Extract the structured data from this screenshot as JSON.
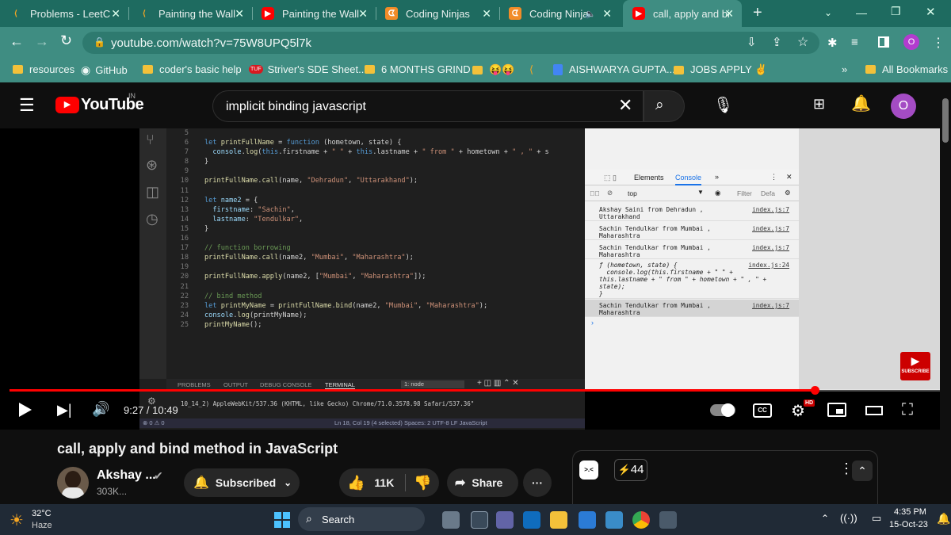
{
  "browser": {
    "tabs": [
      {
        "title": "Problems - LeetC",
        "icon": "leetcode-icon"
      },
      {
        "title": "Painting the Wall",
        "icon": "leetcode-icon"
      },
      {
        "title": "Painting the Wall",
        "icon": "youtube-icon"
      },
      {
        "title": "Coding Ninjas",
        "icon": "codingninjas-icon"
      },
      {
        "title": "Coding Ninja",
        "icon": "codingninjas-icon"
      },
      {
        "title": "call, apply and bi",
        "icon": "youtube-icon",
        "active": true
      }
    ],
    "new_tab": "+",
    "url": "youtube.com/watch?v=75W8UPQ5l7k",
    "profile_initial": "O",
    "bookmarks": [
      {
        "label": "resources",
        "icon": "folder-icon"
      },
      {
        "label": "GitHub",
        "icon": "github-icon"
      },
      {
        "label": "coder's basic help",
        "icon": "folder-icon"
      },
      {
        "label": "Striver's SDE Sheet...",
        "icon": "tuf-icon"
      },
      {
        "label": "6 MONTHS GRIND",
        "icon": "folder-icon"
      },
      {
        "label": "😝😝",
        "icon": "folder-icon"
      },
      {
        "label": "AISHWARYA GUPTA...",
        "icon": "docs-icon"
      },
      {
        "label": "JOBS APPLY ✌",
        "icon": "folder-icon"
      }
    ],
    "bookmarks_overflow": "»",
    "all_bookmarks": "All Bookmarks"
  },
  "youtube": {
    "logo_text": "YouTube",
    "region": "IN",
    "search_query": "implicit binding javascript",
    "avatar_initial": "O"
  },
  "video": {
    "code_lines": [
      {
        "n": "5",
        "html": ""
      },
      {
        "n": "6",
        "html": "<span class='kw'>let</span> <span class='fn'>printFullName</span> = <span class='kw'>function</span> (hometown, state) {"
      },
      {
        "n": "7",
        "html": "  <span class='pr'>console</span>.<span class='fn'>log</span>(<span class='kw'>this</span>.firstname + <span class='str'>\" \"</span> + <span class='kw'>this</span>.lastname + <span class='str'>\" from \"</span> + hometown + <span class='str'>\" , \"</span> + s"
      },
      {
        "n": "8",
        "html": "}"
      },
      {
        "n": "9",
        "html": ""
      },
      {
        "n": "10",
        "html": "<span class='fn'>printFullName</span>.<span class='fn'>call</span>(name, <span class='str'>\"Dehradun\"</span>, <span class='str'>\"Uttarakhand\"</span>);"
      },
      {
        "n": "11",
        "html": ""
      },
      {
        "n": "12",
        "html": "<span class='kw'>let</span> <span class='pr'>name2</span> = {"
      },
      {
        "n": "13",
        "html": "  <span class='pr'>firstname</span>: <span class='str'>\"Sachin\"</span>,"
      },
      {
        "n": "14",
        "html": "  <span class='pr'>lastname</span>: <span class='str'>\"Tendulkar\"</span>,"
      },
      {
        "n": "15",
        "html": "}"
      },
      {
        "n": "16",
        "html": ""
      },
      {
        "n": "17",
        "html": "<span class='cm'>// function borrowing</span>"
      },
      {
        "n": "18",
        "html": "<span class='fn'>printFullName</span>.<span class='fn'>call</span>(name2, <span class='str'>\"Mumbai\"</span>, <span class='str'>\"Maharashtra\"</span>);"
      },
      {
        "n": "19",
        "html": ""
      },
      {
        "n": "20",
        "html": "<span class='fn'>printFullName</span>.<span class='fn'>apply</span>(name2, [<span class='str'>\"Mumbai\"</span>, <span class='str'>\"Maharashtra\"</span>]);"
      },
      {
        "n": "21",
        "html": ""
      },
      {
        "n": "22",
        "html": "<span class='cm'>// bind method</span>"
      },
      {
        "n": "23",
        "html": "<span class='kw'>let</span> <span class='fn'>printMyName</span> = <span class='fn'>printFullName</span>.<span class='fn'>bind</span>(name2, <span class='str'>\"Mumbai\"</span>, <span class='str'>\"Maharashtra\"</span>);"
      },
      {
        "n": "24",
        "html": "<span class='pr'>console</span>.<span class='fn'>log</span>(printMyName);"
      },
      {
        "n": "25",
        "html": "<span class='fn'>printMyName</span>();"
      }
    ],
    "panel_tabs": [
      "PROBLEMS",
      "OUTPUT",
      "DEBUG CONSOLE",
      "TERMINAL"
    ],
    "terminal_select": "1: node",
    "terminal_text": "10_14_2) AppleWebKit/537.36 (KHTML, like Gecko) Chrome/71.0.3578.98 Safari/537.36\"",
    "status_left": "⊗ 0 ⚠ 0",
    "status_right": "Ln 18, Col 19 (4 selected)   Spaces: 2   UTF-8   LF   JavaScript",
    "devtools_tabs": [
      "Elements",
      "Console"
    ],
    "devtools_more": "»",
    "console_context": "top",
    "console_filter": "Filter",
    "console_levels": "Defa",
    "console_rows": [
      {
        "text": "Akshay Saini from Dehradun ,\nUttarakhand",
        "link": "index.js:7"
      },
      {
        "text": "Sachin Tendulkar from Mumbai ,\nMaharashtra",
        "link": "index.js:7"
      },
      {
        "text": "Sachin Tendulkar from Mumbai ,\nMaharashtra",
        "link": "index.js:7"
      },
      {
        "text": "ƒ (hometown, state) {\n  console.log(this.firstname + \" \" +\nthis.lastname + \" from \" + hometown + \" , \" +\nstate);\n}",
        "link": "index.js:24"
      },
      {
        "text": "Sachin Tendulkar from Mumbai ,\nMaharashtra",
        "link": "index.js:7"
      }
    ],
    "subscribe_badge": "SUBSCRIBE",
    "time": "9:27 / 10:49",
    "progress_fraction": 0.865,
    "cc_label": "CC",
    "hd_badge": "HD"
  },
  "meta": {
    "title": "call, apply and bind method in JavaScript",
    "channel": "Akshay ...",
    "subscribers": "303K...",
    "subscribed_label": "Subscribed",
    "likes": "11K",
    "share_label": "Share",
    "chat_face": ">.<",
    "chat_count": "44"
  },
  "taskbar": {
    "temp": "32°C",
    "weather": "Haze",
    "search_label": "Search",
    "time": "4:35 PM",
    "date": "15-Oct-23"
  }
}
